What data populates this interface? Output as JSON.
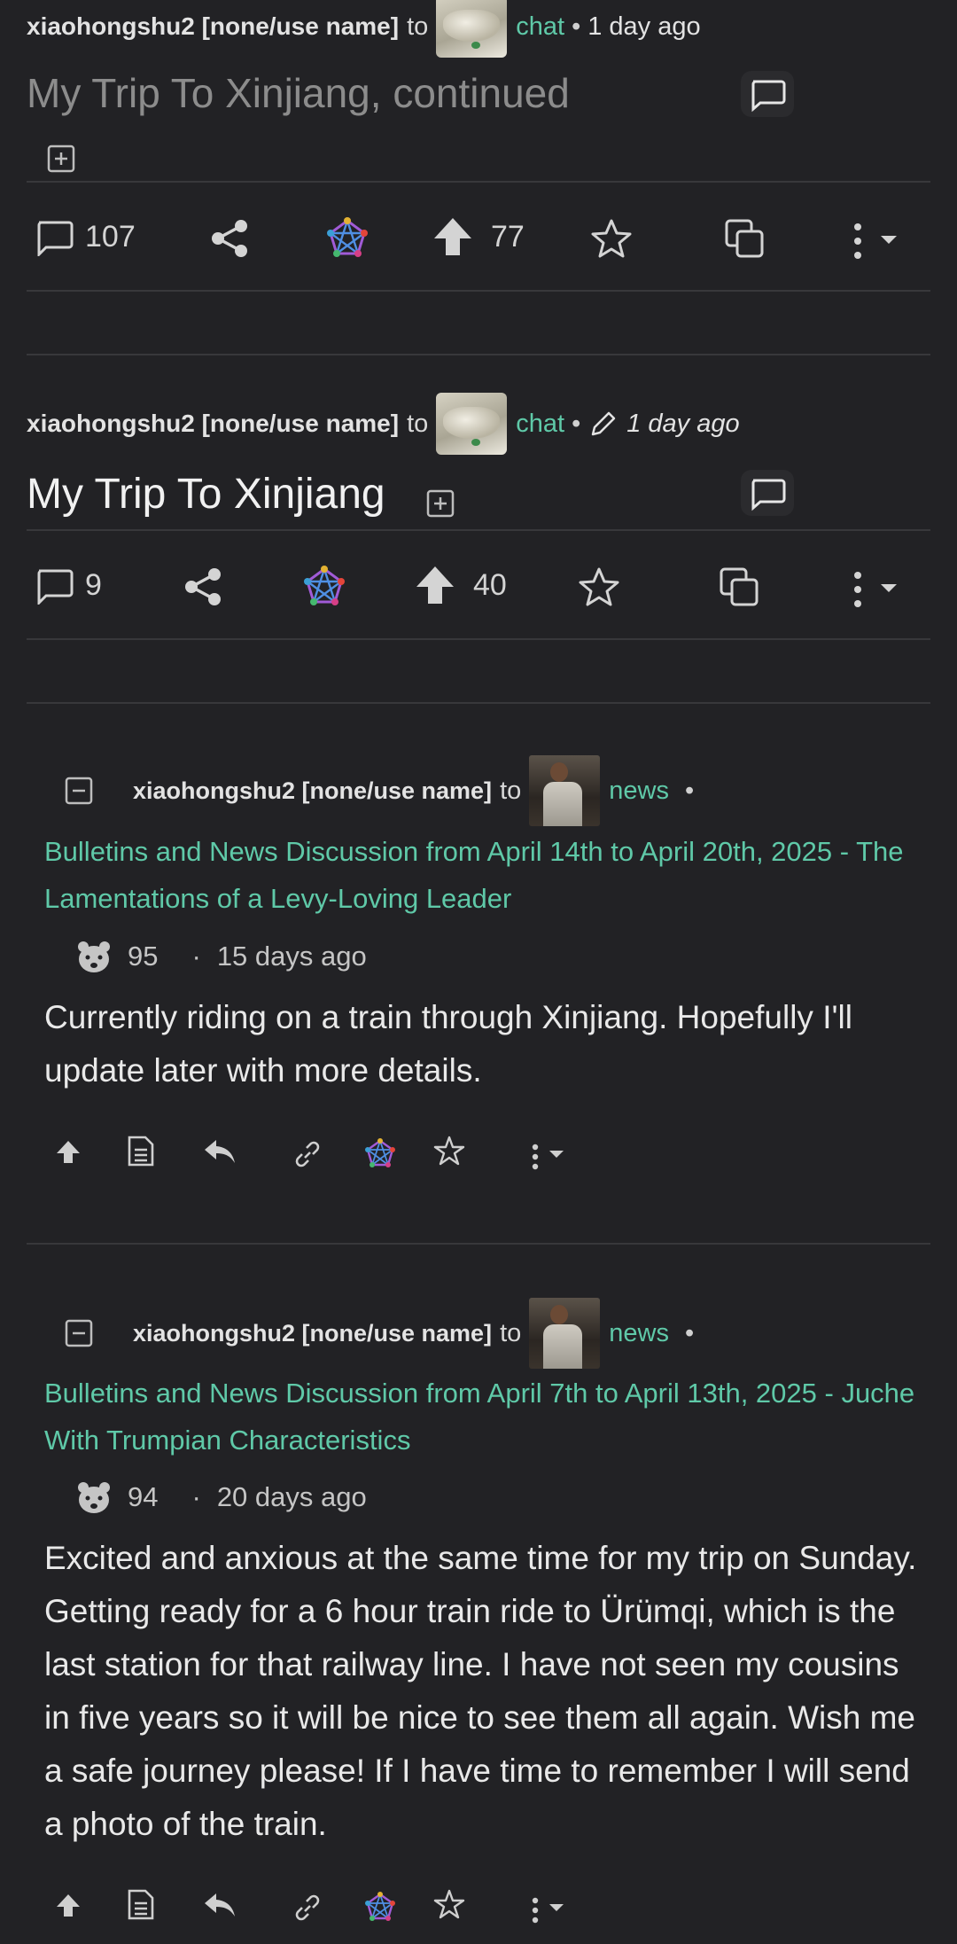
{
  "posts": [
    {
      "user": "xiaohongshu2 [none/use name]",
      "to": "to",
      "community": "chat",
      "separator": "•",
      "time": "1 day ago",
      "title": "My Trip To Xinjiang, continued",
      "comments": "107",
      "score": "77"
    },
    {
      "user": "xiaohongshu2 [none/use name]",
      "to": "to",
      "community": "chat",
      "separator": "•",
      "time": "1 day ago",
      "title": "My Trip To Xinjiang",
      "comments": "9",
      "score": "40"
    }
  ],
  "comments": [
    {
      "user": "xiaohongshu2 [none/use name]",
      "to": "to",
      "community": "news",
      "separator": "•",
      "post_title": "Bulletins and News Discussion from April 14th to April 20th, 2025 - The Lamentations of a Levy-Loving Leader",
      "score": "95",
      "dot": "·",
      "time": "15 days ago",
      "text": "Currently riding on a train through Xinjiang. Hopefully I'll update later with more details."
    },
    {
      "user": "xiaohongshu2 [none/use name]",
      "to": "to",
      "community": "news",
      "separator": "•",
      "post_title": "Bulletins and News Discussion from April 7th to April 13th, 2025 - Juche With Trumpian Characteristics",
      "score": "94",
      "dot": "·",
      "time": "20 days ago",
      "text": "Excited and anxious at the same time for my trip on Sunday. Getting ready for a 6 hour train ride to Ürümqi, which is the last station for that railway line. I have not seen my cousins in five years so it will be nice to see them all again. Wish me a safe journey please! If I have time to remember I will send a photo of the train."
    }
  ],
  "colors": {
    "background": "#222225",
    "accent": "#5fc9a8",
    "text": "#e9e9e9",
    "muted": "#8c8c8c"
  },
  "icons": [
    "comment-icon",
    "share-icon",
    "fediverse-icon",
    "upvote-icon",
    "star-icon",
    "copy-icon",
    "more-icon",
    "chevron-down-icon",
    "expand-icon",
    "collapse-icon",
    "bear-icon",
    "source-icon",
    "reply-icon",
    "link-icon",
    "pencil-icon"
  ]
}
